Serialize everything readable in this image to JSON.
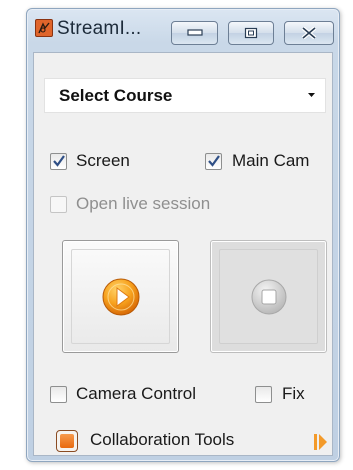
{
  "window": {
    "title": "StreamI...",
    "title_icon": "app-logo-icon",
    "controls": {
      "minimize_icon": "minimize-icon",
      "maximize_icon": "restore-icon",
      "close_icon": "close-icon"
    }
  },
  "course_select": {
    "value": "Select Course",
    "arrow_icon": "dropdown-arrow-icon"
  },
  "options": {
    "screen": {
      "label": "Screen",
      "checked": true
    },
    "main_cam": {
      "label": "Main Cam",
      "checked": true
    },
    "open_live_session": {
      "label": "Open live session",
      "checked": false,
      "enabled": false
    }
  },
  "controls": {
    "play_icon": "play-icon",
    "stop_icon": "stop-icon",
    "stop_enabled": false
  },
  "bottom": {
    "camera_control": {
      "label": "Camera Control",
      "checked": false
    },
    "fix": {
      "label": "Fix",
      "checked": false
    },
    "collaboration_tools": {
      "label": "Collaboration Tools",
      "icon": "collaboration-icon"
    },
    "expand_icon": "expand-arrow-icon"
  },
  "colors": {
    "accent_orange": "#f28a1c",
    "titlebar": "#c9d8e8",
    "panel": "#f0f0f0"
  }
}
